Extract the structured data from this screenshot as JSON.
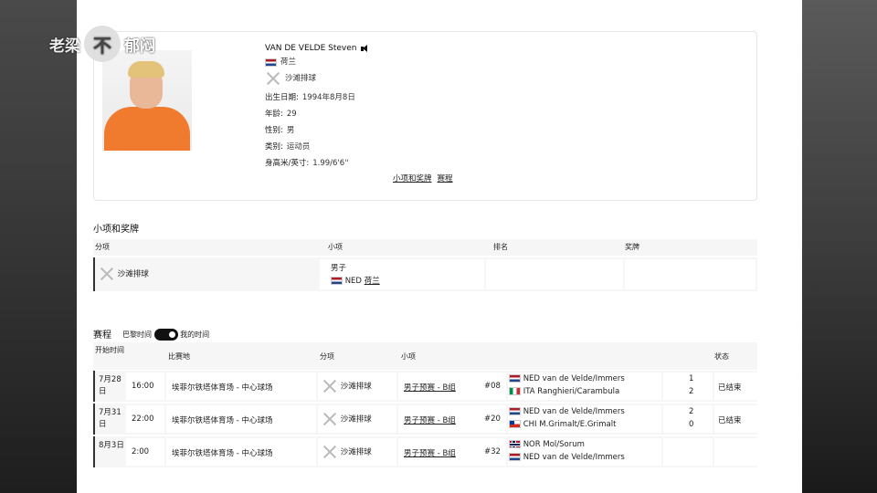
{
  "watermark": {
    "left": "老梁",
    "circle": "不",
    "right": "郁闷"
  },
  "profile": {
    "name": "VAN DE VELDE Steven",
    "country": "荷兰",
    "sport": "沙滩排球",
    "birth_label": "出生日期:",
    "birth_value": "1994年8月8日",
    "age_label": "年龄:",
    "age_value": "29",
    "gender_label": "性别:",
    "gender_value": "男",
    "category_label": "类别:",
    "category_value": "运动员",
    "height_label": "身高米/英寸:",
    "height_value": "1.99/6'6''",
    "link_events": "小项和奖牌",
    "link_schedule": "赛程"
  },
  "events": {
    "title": "小项和奖牌",
    "headers": [
      "分项",
      "小项",
      "排名",
      "奖牌"
    ],
    "row": {
      "discipline": "沙滩排球",
      "event": "男子",
      "noc": "NED",
      "country": "荷兰"
    }
  },
  "schedule": {
    "title": "赛程",
    "toggle_left": "巴黎时间",
    "toggle_right": "我的时间",
    "headers": [
      "开始时间",
      "比赛地",
      "分项",
      "小项",
      "状态"
    ],
    "rows": [
      {
        "date": "7月28日",
        "time": "16:00",
        "venue": "埃菲尔铁塔体育场 - 中心球场",
        "discipline": "沙滩排球",
        "event": "男子预赛 - B组",
        "match": "#08",
        "team1": "NED van de Velde/Immers",
        "score1": "1",
        "team2": "ITA Ranghieri/Carambula",
        "score2": "2",
        "status": "已结束"
      },
      {
        "date": "7月31日",
        "time": "22:00",
        "venue": "埃菲尔铁塔体育场 - 中心球场",
        "discipline": "沙滩排球",
        "event": "男子预赛 - B组",
        "match": "#20",
        "team1": "NED van de Velde/Immers",
        "score1": "2",
        "team2": "CHI M.Grimalt/E.Grimalt",
        "score2": "0",
        "status": "已结束"
      },
      {
        "date": "8月3日",
        "time": "2:00",
        "venue": "埃菲尔铁塔体育场 - 中心球场",
        "discipline": "沙滩排球",
        "event": "男子预赛 - B组",
        "match": "#32",
        "team1": "NOR Mol/Sorum",
        "score1": "",
        "team2": "NED van de Velde/Immers",
        "score2": "",
        "status": ""
      }
    ]
  }
}
